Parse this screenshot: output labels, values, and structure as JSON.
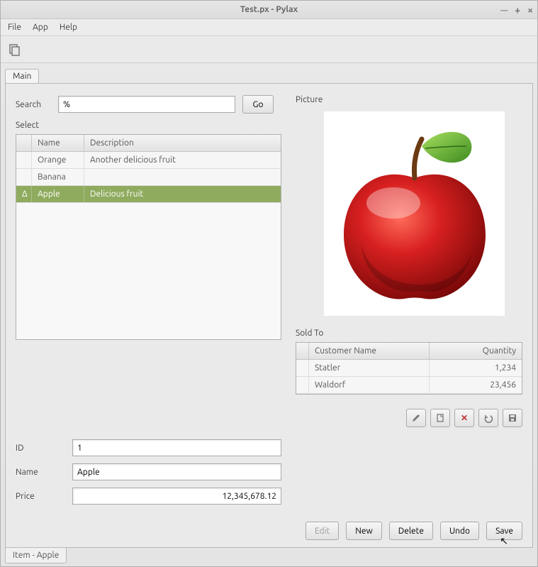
{
  "window": {
    "title": "Test.px - Pylax"
  },
  "menu": {
    "file": "File",
    "app": "App",
    "help": "Help"
  },
  "tabs": {
    "main": "Main"
  },
  "search": {
    "label": "Search",
    "value": "%",
    "go": "Go"
  },
  "select": {
    "label": "Select",
    "headers": {
      "name": "Name",
      "description": "Description"
    },
    "rows": [
      {
        "mark": "",
        "name": "Orange",
        "description": "Another delicious fruit",
        "selected": false
      },
      {
        "mark": "",
        "name": "Banana",
        "description": "",
        "selected": false
      },
      {
        "mark": "Δ",
        "name": "Apple",
        "description": "Delicious fruit",
        "selected": true
      }
    ]
  },
  "fields": {
    "id_label": "ID",
    "id_value": "1",
    "name_label": "Name",
    "name_value": "Apple",
    "price_label": "Price",
    "price_value": "12,345,678.12"
  },
  "picture": {
    "label": "Picture"
  },
  "soldto": {
    "label": "Sold To",
    "headers": {
      "customer": "Customer Name",
      "quantity": "Quantity"
    },
    "rows": [
      {
        "customer": "Statler",
        "quantity": "1,234"
      },
      {
        "customer": "Waldorf",
        "quantity": "23,456"
      }
    ]
  },
  "buttons": {
    "edit": "Edit",
    "new": "New",
    "delete": "Delete",
    "undo": "Undo",
    "save": "Save"
  },
  "bottom_tab": "Item  -  Apple",
  "icons": {
    "pencil": "pencil-icon",
    "copy": "copy-icon",
    "delete": "delete-icon",
    "undo": "undo-icon",
    "save": "save-icon"
  }
}
